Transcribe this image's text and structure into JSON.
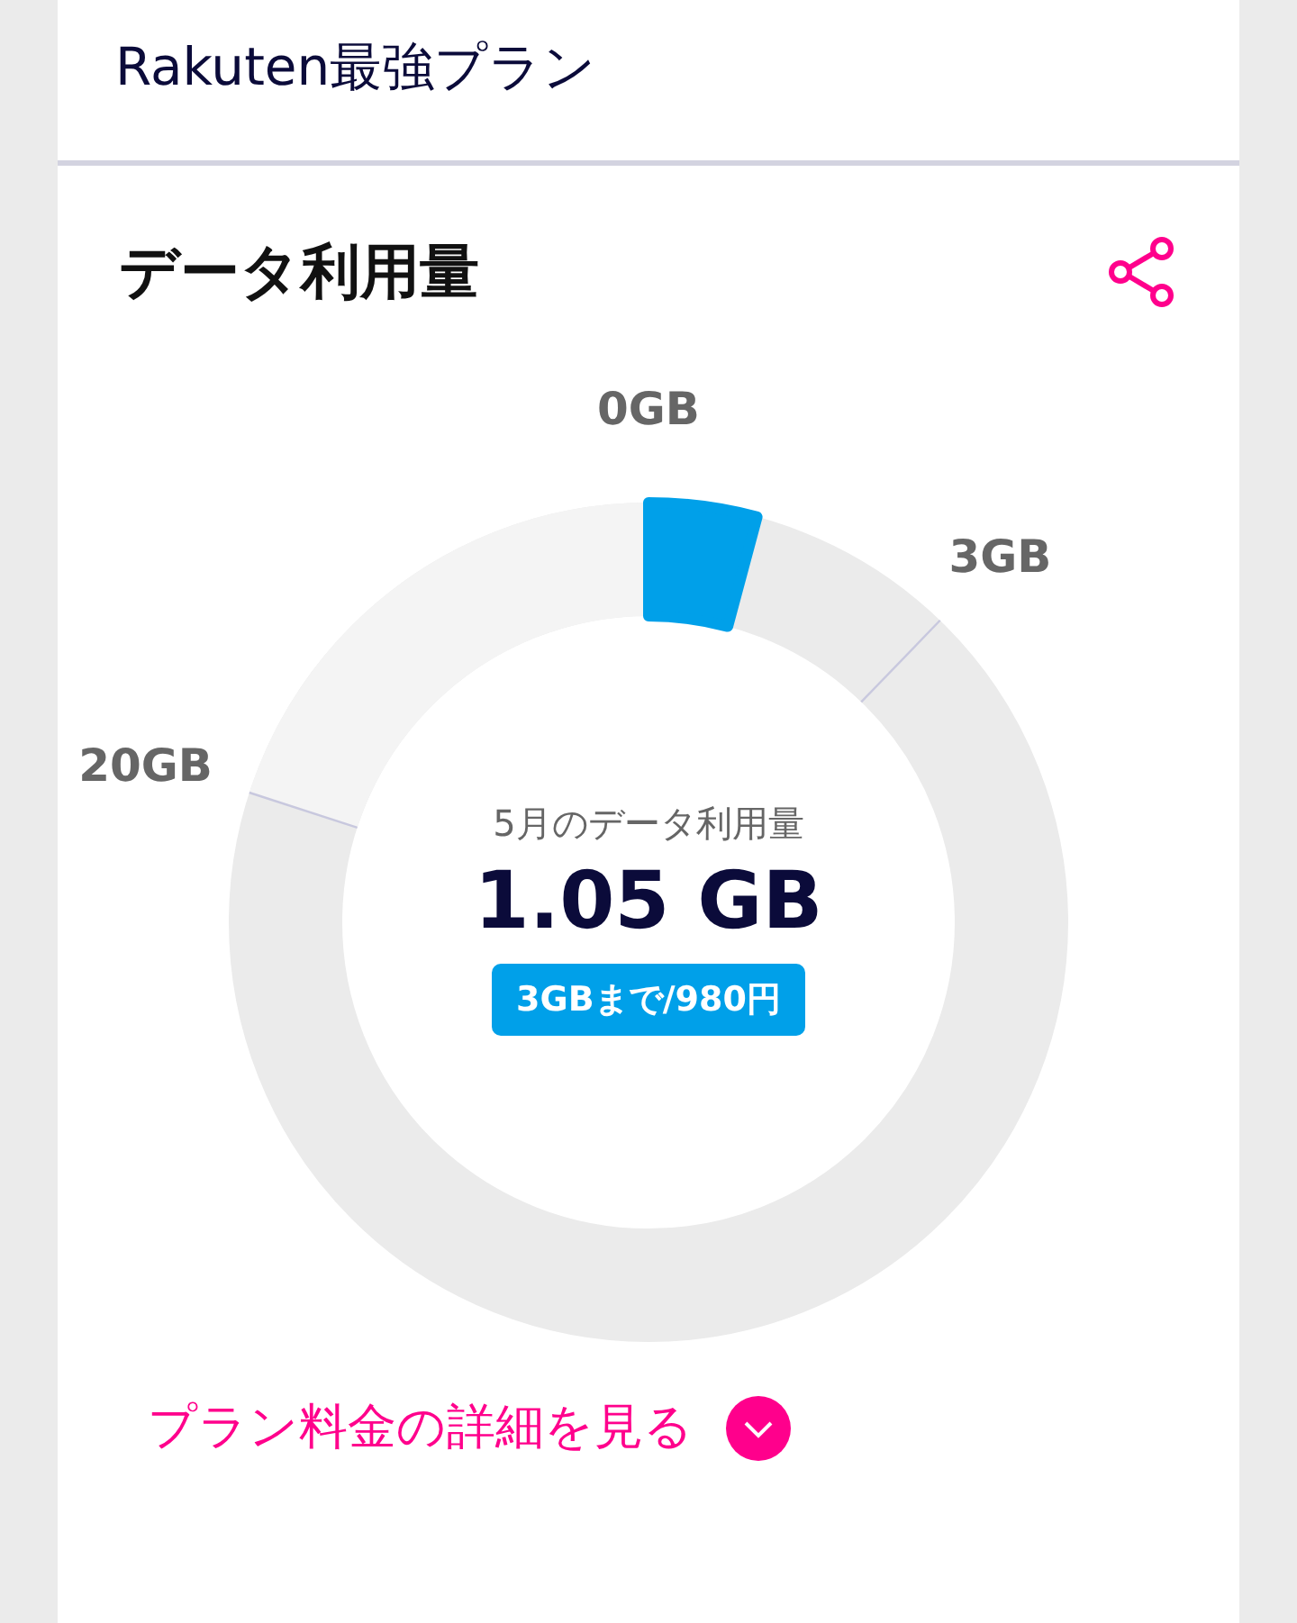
{
  "plan": {
    "name": "Rakuten最強プラン"
  },
  "usage": {
    "title": "データ利用量",
    "gauge": {
      "ticks": [
        {
          "label": "0GB"
        },
        {
          "label": "3GB"
        },
        {
          "label": "20GB"
        }
      ],
      "caption": "5月のデータ利用量",
      "amount": "1.05 GB",
      "tier": "3GBまで/980円"
    },
    "details_link": "プラン料金の詳細を見る"
  }
}
